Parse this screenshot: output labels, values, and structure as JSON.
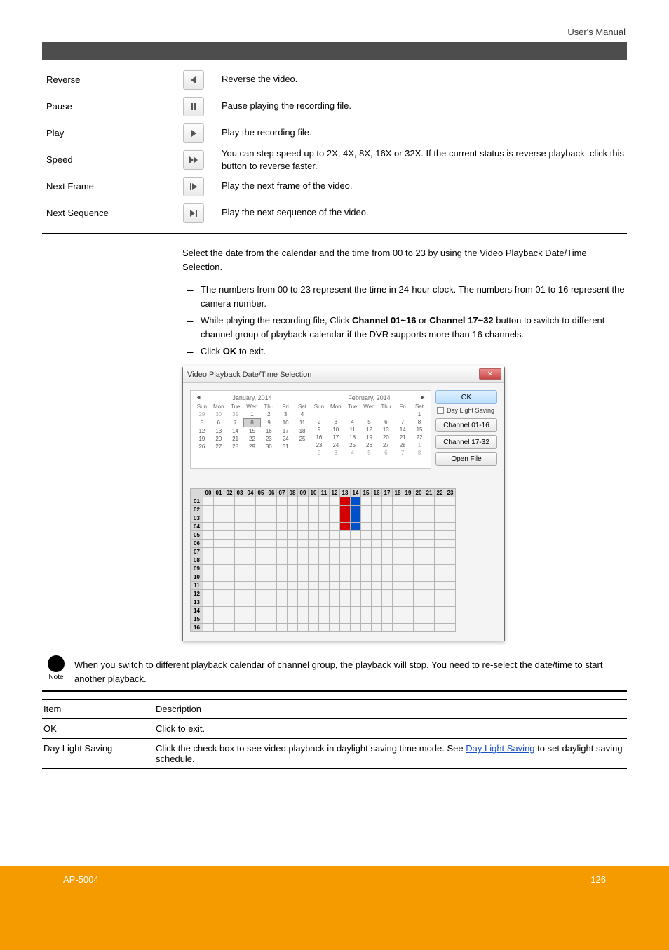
{
  "header": {
    "usermanual": "User's Manual"
  },
  "controls": {
    "reverse": {
      "label": "Reverse",
      "desc": "Reverse the video."
    },
    "pause": {
      "label": "Pause",
      "desc": "Pause playing the recording file."
    },
    "play": {
      "label": "Play",
      "desc": "Play the recording file."
    },
    "speed": {
      "label": "Speed",
      "desc": "You can step speed up to 2X, 4X, 8X, 16X or 32X. If the current status is reverse playback, click this button to reverse faster."
    },
    "next_frame": {
      "label": "Next Frame",
      "desc": "Play the next frame of the video."
    },
    "next_seq": {
      "label": "Next Sequence",
      "desc": "Play the next sequence of the video."
    }
  },
  "para": {
    "main_para": "Select the date from the calendar and the time from 00 to 23 by using the Video Playback Date/Time Selection.",
    "b1_a": "The numbers from 00 to 23 represent the time in 24-hour clock. The numbers from 01 to ",
    "b1_b": "16 represent the camera number.",
    "b2_a": "While playing the recording file, Click ",
    "b2_bold": "Channel 01~16",
    "b2_c": " or ",
    "b2_bold2": "Channel 17~32",
    "b2_d": " button to switch to different channel group of playback calendar if the DVR supports more than 16 channels.",
    "b3a": "Click ",
    "b3b": "OK",
    "b3c": " to exit."
  },
  "dialog": {
    "title": "Video Playback Date/Time Selection",
    "ok": "OK",
    "dls": "Day Light Saving",
    "ch1": "Channel 01-16",
    "ch2": "Channel 17-32",
    "openfile": "Open File",
    "jan": {
      "name": "January, 2014",
      "days": [
        "Sun",
        "Mon",
        "Tue",
        "Wed",
        "Thu",
        "Fri",
        "Sat"
      ],
      "grid": [
        [
          "29",
          "30",
          "31",
          "1",
          "2",
          "3",
          "4"
        ],
        [
          "5",
          "6",
          "7",
          "8",
          "9",
          "10",
          "11"
        ],
        [
          "12",
          "13",
          "14",
          "15",
          "16",
          "17",
          "18"
        ],
        [
          "19",
          "20",
          "21",
          "22",
          "23",
          "24",
          "25"
        ],
        [
          "26",
          "27",
          "28",
          "29",
          "30",
          "31",
          ""
        ]
      ],
      "dimCols0": [
        0,
        1,
        2
      ],
      "today": [
        1,
        3
      ]
    },
    "feb": {
      "name": "February, 2014",
      "days": [
        "Sun",
        "Mon",
        "Tue",
        "Wed",
        "Thu",
        "Fri",
        "Sat"
      ],
      "grid": [
        [
          "",
          "",
          "",
          "",
          "",
          "",
          "1"
        ],
        [
          "2",
          "3",
          "4",
          "5",
          "6",
          "7",
          "8"
        ],
        [
          "9",
          "10",
          "11",
          "12",
          "13",
          "14",
          "15"
        ],
        [
          "16",
          "17",
          "18",
          "19",
          "20",
          "21",
          "22"
        ],
        [
          "23",
          "24",
          "25",
          "26",
          "27",
          "28",
          "1"
        ],
        [
          "2",
          "3",
          "4",
          "5",
          "6",
          "7",
          "8"
        ]
      ],
      "dimRow": 5
    },
    "hours": [
      "00",
      "01",
      "02",
      "03",
      "04",
      "05",
      "06",
      "07",
      "08",
      "09",
      "10",
      "11",
      "12",
      "13",
      "14",
      "15",
      "16",
      "17",
      "18",
      "19",
      "20",
      "21",
      "22",
      "23"
    ],
    "rows": [
      "01",
      "02",
      "03",
      "04",
      "05",
      "06",
      "07",
      "08",
      "09",
      "10",
      "11",
      "12",
      "13",
      "14",
      "15",
      "16"
    ],
    "record": {
      "red": [
        [
          0,
          13
        ],
        [
          1,
          13
        ],
        [
          2,
          13
        ],
        [
          3,
          13
        ]
      ],
      "blue": [
        [
          0,
          14
        ],
        [
          1,
          14
        ],
        [
          2,
          14
        ],
        [
          3,
          14
        ]
      ]
    }
  },
  "note": {
    "label": "Note",
    "text": "When you switch to different playback calendar of channel group, the playback will stop. You need to re-select the date/time to start another playback."
  },
  "desc_table": {
    "h_item": "Item",
    "h_desc": "Description",
    "ok_item": "OK",
    "ok_desc": "Click to exit.",
    "dls_item": "Day Light Saving",
    "dls_desc_a": "Click the check box to see video playback in daylight saving time mode. See ",
    "dls_link": "Day Light Saving",
    "dls_desc_b": " to set daylight saving schedule."
  },
  "footer": {
    "doc": "AP-5004",
    "page": "126"
  }
}
